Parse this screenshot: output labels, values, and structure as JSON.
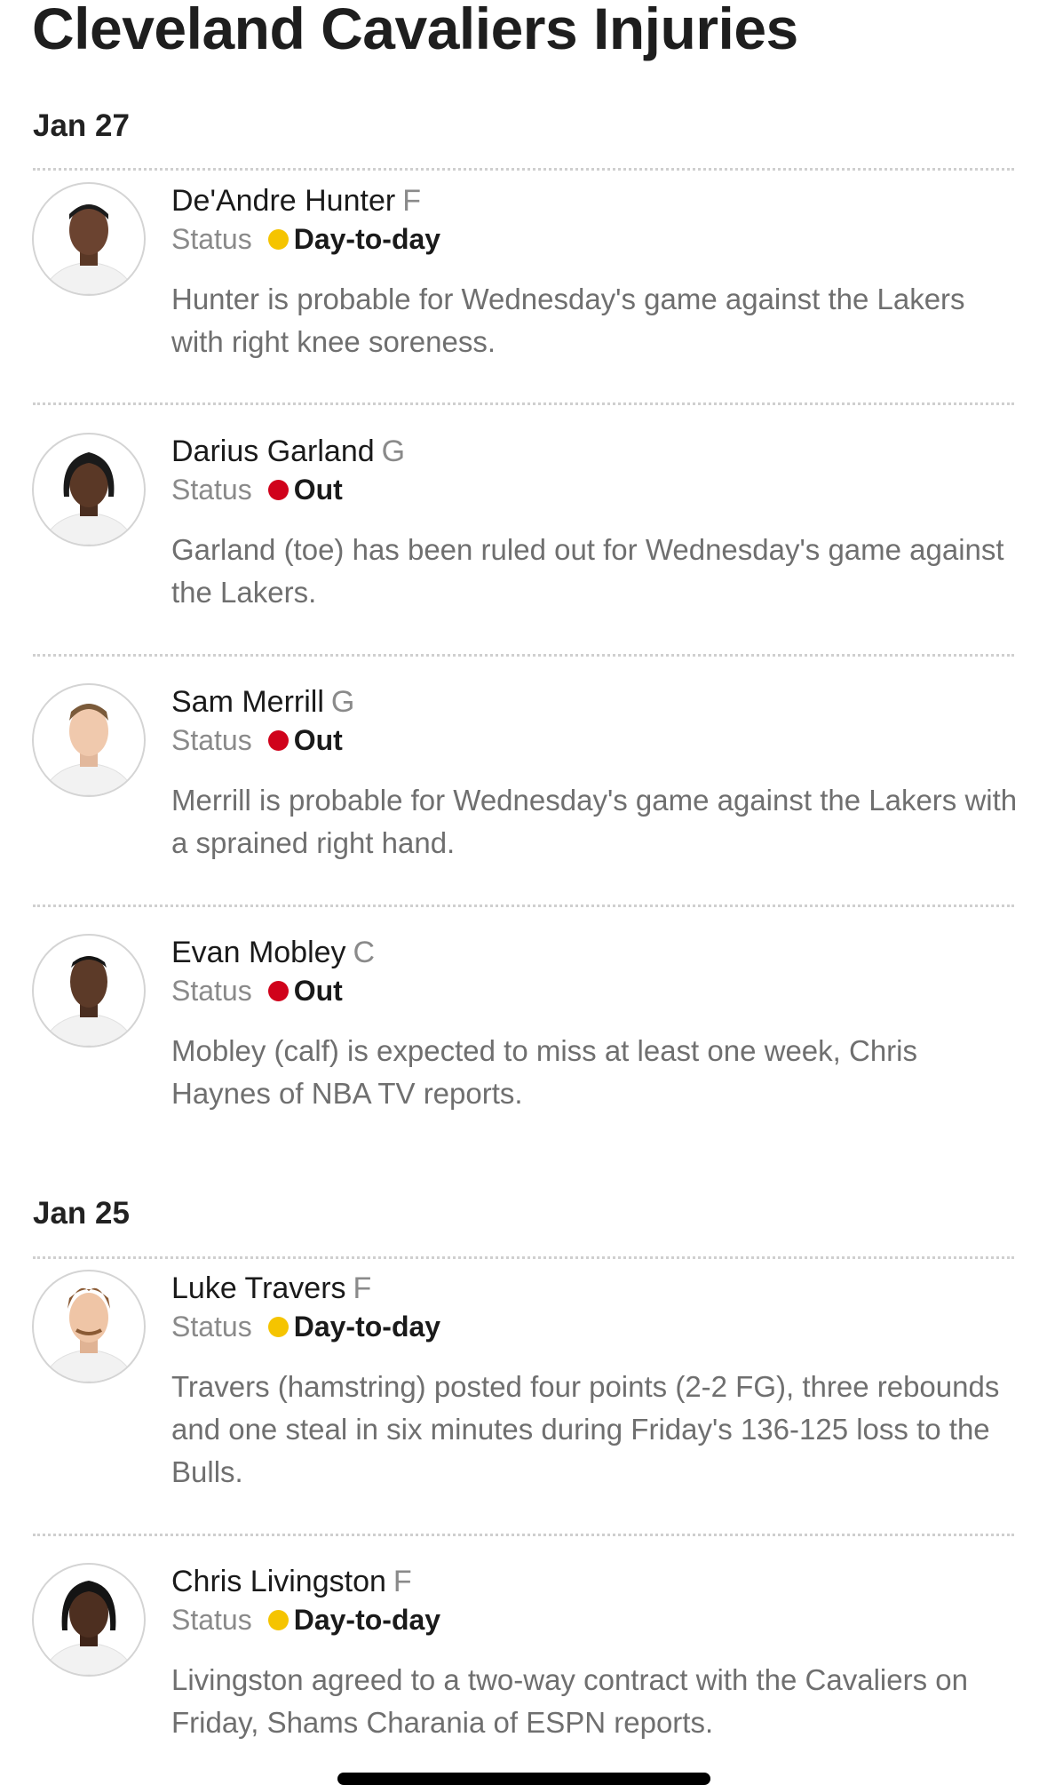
{
  "page": {
    "title": "Cleveland Cavaliers Injuries"
  },
  "colors": {
    "day_to_day": "#f5c400",
    "out": "#d0021b"
  },
  "groups": [
    {
      "date": "Jan 27",
      "players": [
        {
          "name": "De'Andre Hunter",
          "position": "F",
          "status_label": "Status",
          "status": "Day-to-day",
          "status_color": "#f5c400",
          "note": "Hunter is probable for Wednesday's game against the Lakers with right knee soreness.",
          "avatar_icon": "player-headshot"
        },
        {
          "name": "Darius Garland",
          "position": "G",
          "status_label": "Status",
          "status": "Out",
          "status_color": "#d0021b",
          "note": "Garland (toe) has been ruled out for Wednesday's game against the Lakers.",
          "avatar_icon": "player-headshot"
        },
        {
          "name": "Sam Merrill",
          "position": "G",
          "status_label": "Status",
          "status": "Out",
          "status_color": "#d0021b",
          "note": "Merrill is probable for Wednesday's game against the Lakers with a sprained right hand.",
          "avatar_icon": "player-headshot"
        },
        {
          "name": "Evan Mobley",
          "position": "C",
          "status_label": "Status",
          "status": "Out",
          "status_color": "#d0021b",
          "note": "Mobley (calf) is expected to miss at least one week, Chris Haynes of NBA TV reports.",
          "avatar_icon": "player-headshot"
        }
      ]
    },
    {
      "date": "Jan 25",
      "players": [
        {
          "name": "Luke Travers",
          "position": "F",
          "status_label": "Status",
          "status": "Day-to-day",
          "status_color": "#f5c400",
          "note": "Travers (hamstring) posted four points (2-2 FG), three rebounds and one steal in six minutes during Friday's 136-125 loss to the Bulls.",
          "avatar_icon": "player-headshot"
        },
        {
          "name": "Chris Livingston",
          "position": "F",
          "status_label": "Status",
          "status": "Day-to-day",
          "status_color": "#f5c400",
          "note": "Livingston agreed to a two-way contract with the Cavaliers on Friday, Shams Charania of ESPN reports.",
          "avatar_icon": "player-headshot"
        }
      ]
    }
  ]
}
